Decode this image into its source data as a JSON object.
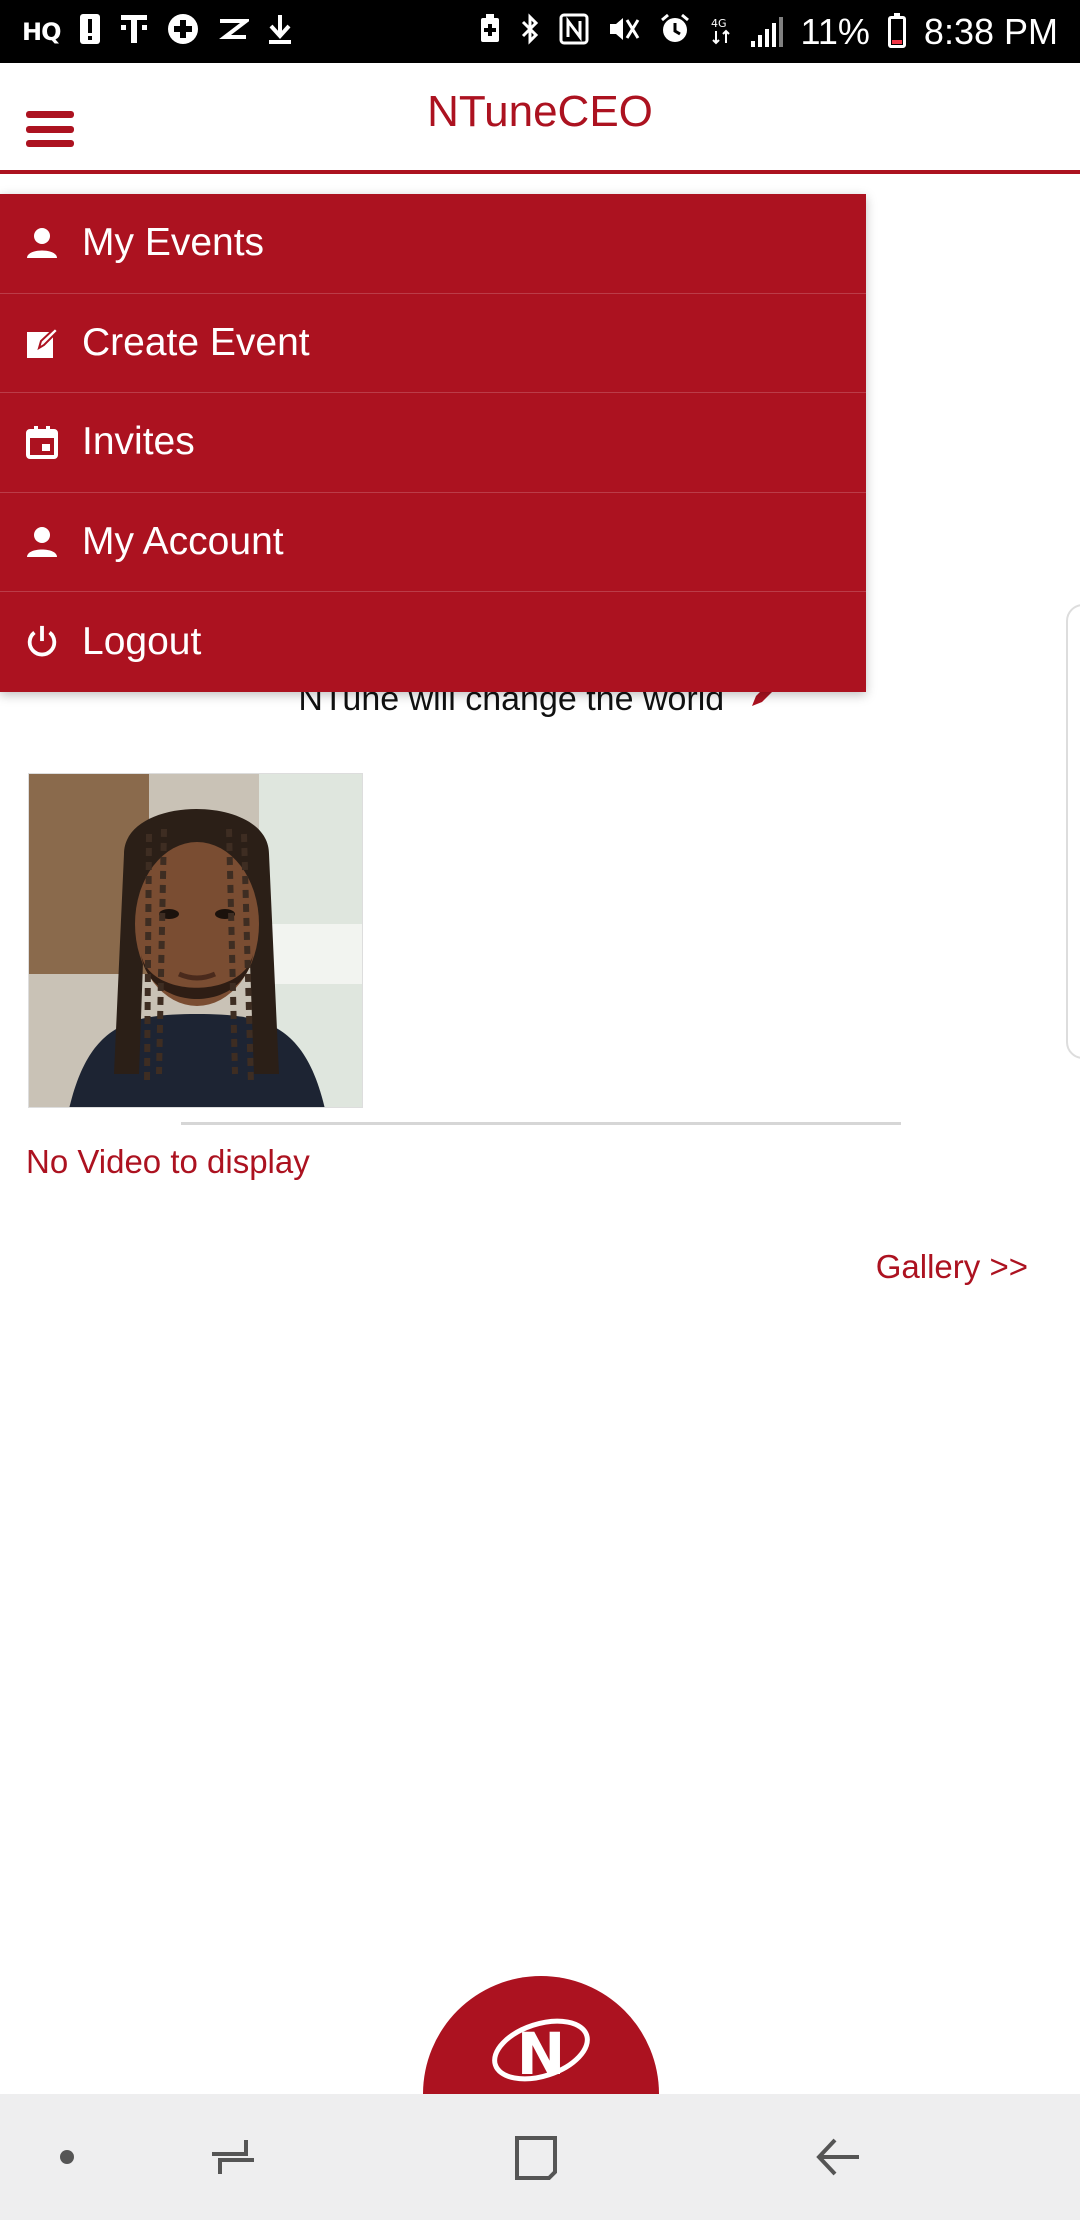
{
  "status_bar": {
    "left_icons": [
      "hq-icon",
      "alert-icon",
      "tmobile-icon",
      "plus-circle-icon",
      "zedge-icon",
      "download-icon"
    ],
    "battery_percent": "11%",
    "time": "8:38 PM"
  },
  "app_bar": {
    "title": "NTuneCEO"
  },
  "drawer": {
    "items": [
      {
        "label": "My Events",
        "icon": "person-icon"
      },
      {
        "label": "Create Event",
        "icon": "edit-note-icon"
      },
      {
        "label": "Invites",
        "icon": "calendar-icon"
      },
      {
        "label": "My Account",
        "icon": "person-icon"
      },
      {
        "label": "Logout",
        "icon": "power-icon"
      }
    ]
  },
  "profile": {
    "bio": "NTune will change the world",
    "no_video_text": "No Video to display",
    "gallery_link": "Gallery >>"
  },
  "fab": {
    "logo_letter": "N"
  },
  "colors": {
    "brand": "#ac1220",
    "nav_background": "#eeeeef"
  }
}
